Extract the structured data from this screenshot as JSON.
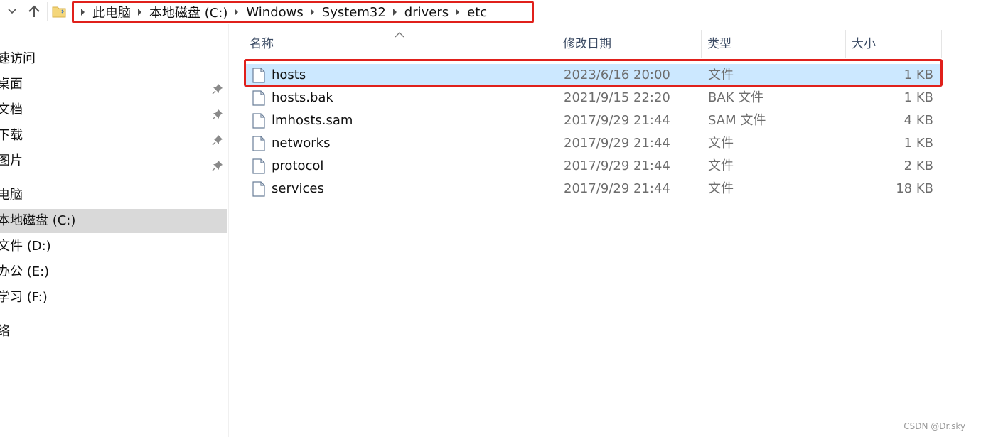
{
  "address_bar": {
    "breadcrumbs": [
      "此电脑",
      "本地磁盘 (C:)",
      "Windows",
      "System32",
      "drivers",
      "etc"
    ],
    "nav_icons": [
      "chevron-down-icon",
      "up-arrow-icon",
      "folder-icon"
    ]
  },
  "nav_pane": {
    "items": [
      {
        "label": "速访问",
        "pinned": false,
        "selected": false
      },
      {
        "label": "桌面",
        "pinned": true,
        "selected": false
      },
      {
        "label": "文档",
        "pinned": true,
        "selected": false
      },
      {
        "label": "下载",
        "pinned": true,
        "selected": false
      },
      {
        "label": "图片",
        "pinned": true,
        "selected": false
      },
      {
        "label": "电脑",
        "pinned": false,
        "selected": false
      },
      {
        "label": "本地磁盘 (C:)",
        "pinned": false,
        "selected": true
      },
      {
        "label": "文件 (D:)",
        "pinned": false,
        "selected": false
      },
      {
        "label": "办公 (E:)",
        "pinned": false,
        "selected": false
      },
      {
        "label": "学习 (F:)",
        "pinned": false,
        "selected": false
      },
      {
        "label": "络",
        "pinned": false,
        "selected": false
      }
    ]
  },
  "file_list": {
    "columns": {
      "name": "名称",
      "modified": "修改日期",
      "type": "类型",
      "size": "大小"
    },
    "files": [
      {
        "name": "hosts",
        "modified": "2023/6/16 20:00",
        "type": "文件",
        "size": "1 KB",
        "selected": true
      },
      {
        "name": "hosts.bak",
        "modified": "2021/9/15 22:20",
        "type": "BAK 文件",
        "size": "1 KB",
        "selected": false
      },
      {
        "name": "lmhosts.sam",
        "modified": "2017/9/29 21:44",
        "type": "SAM 文件",
        "size": "4 KB",
        "selected": false
      },
      {
        "name": "networks",
        "modified": "2017/9/29 21:44",
        "type": "文件",
        "size": "1 KB",
        "selected": false
      },
      {
        "name": "protocol",
        "modified": "2017/9/29 21:44",
        "type": "文件",
        "size": "2 KB",
        "selected": false
      },
      {
        "name": "services",
        "modified": "2017/9/29 21:44",
        "type": "文件",
        "size": "18 KB",
        "selected": false
      }
    ]
  },
  "colors": {
    "highlight_red": "#e0201b",
    "selected_row": "#cce8ff",
    "selected_nav": "#d9d9d9"
  },
  "watermark": "CSDN @Dr.sky_"
}
